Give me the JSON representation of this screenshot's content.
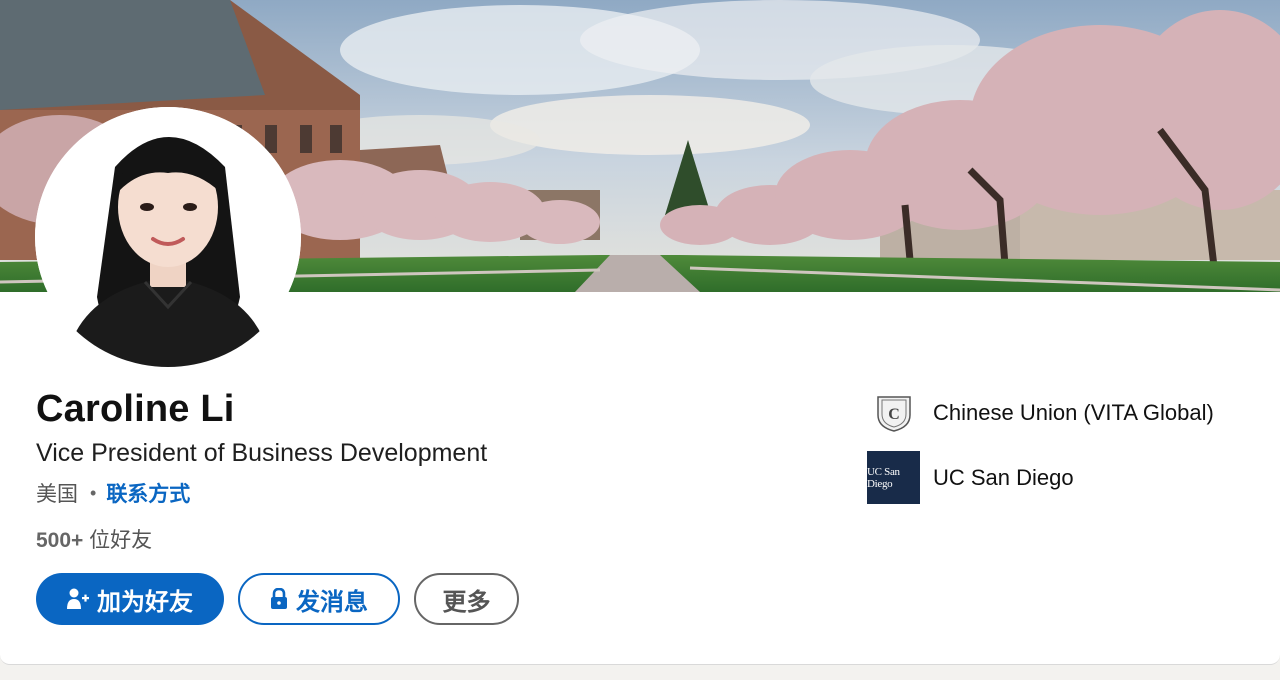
{
  "profile": {
    "name": "Caroline Li",
    "headline": "Vice President of Business Development",
    "location": "美国",
    "contact_link": "联系方式",
    "connections_count": "500+",
    "connections_suffix": " 位好友"
  },
  "actions": {
    "connect_label": "加为好友",
    "message_label": "发消息",
    "more_label": "更多"
  },
  "organizations": [
    {
      "name": "Chinese Union (VITA Global)"
    },
    {
      "name": "UC San Diego",
      "logo_text": "UC San Diego"
    }
  ],
  "colors": {
    "accent": "#0a66c2",
    "ucsd_navy": "#182b49"
  }
}
